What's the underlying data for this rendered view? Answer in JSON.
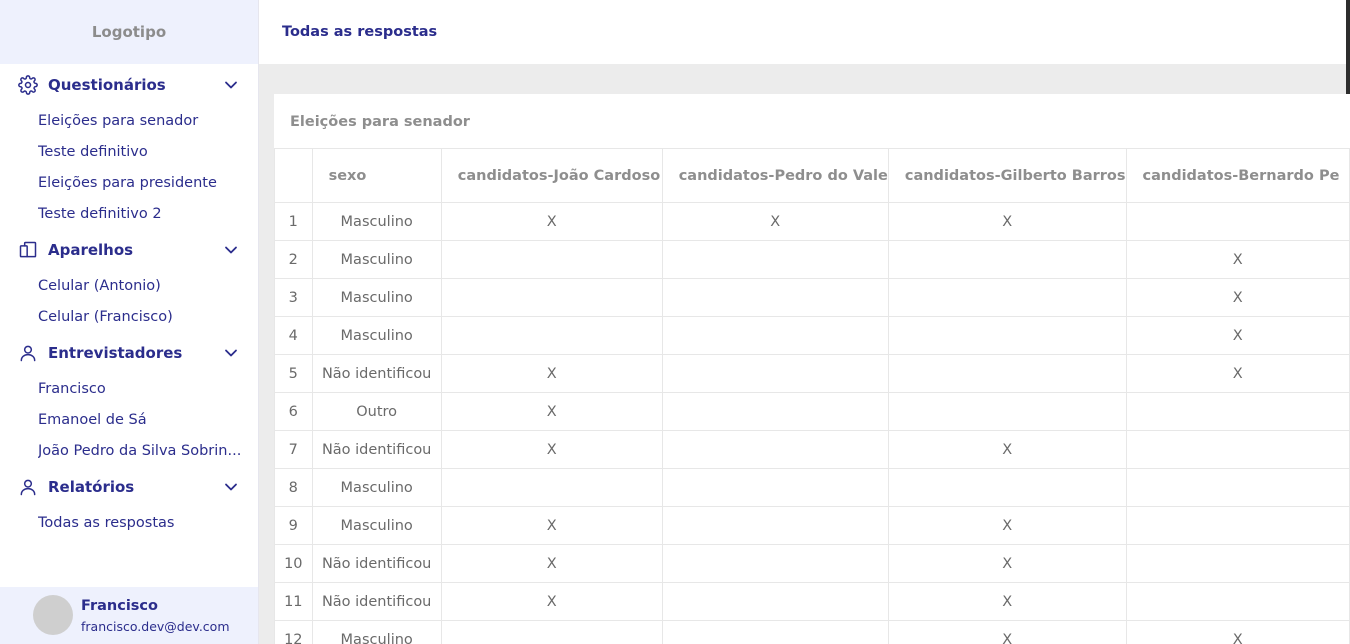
{
  "sidebar": {
    "logo": "Logotipo",
    "sections": [
      {
        "title": "Questionários",
        "icon": "gear-icon",
        "items": [
          "Eleições para senador",
          "Teste definitivo",
          "Eleições para presidente",
          "Teste definitivo 2"
        ]
      },
      {
        "title": "Aparelhos",
        "icon": "devices-icon",
        "items": [
          "Celular (Antonio)",
          "Celular (Francisco)"
        ]
      },
      {
        "title": "Entrevistadores",
        "icon": "user-icon",
        "items": [
          "Francisco",
          "Emanoel de Sá",
          "João Pedro da Silva Sobrin..."
        ]
      },
      {
        "title": "Relatórios",
        "icon": "user-icon",
        "items": [
          "Todas as respostas"
        ]
      }
    ],
    "user": {
      "name": "Francisco",
      "email": "francisco.dev@dev.com"
    }
  },
  "header": {
    "title": "Todas as respostas"
  },
  "card": {
    "title": "Eleições para senador",
    "columns": [
      "",
      "sexo",
      "candidatos-João Cardoso",
      "candidatos-Pedro do Vale",
      "candidatos-Gilberto Barros",
      "candidatos-Bernardo Pe"
    ],
    "rows": [
      [
        "1",
        "Masculino",
        "X",
        "X",
        "X",
        ""
      ],
      [
        "2",
        "Masculino",
        "",
        "",
        "",
        "X"
      ],
      [
        "3",
        "Masculino",
        "",
        "",
        "",
        "X"
      ],
      [
        "4",
        "Masculino",
        "",
        "",
        "",
        "X"
      ],
      [
        "5",
        "Não identificou",
        "X",
        "",
        "",
        "X"
      ],
      [
        "6",
        "Outro",
        "X",
        "",
        "",
        ""
      ],
      [
        "7",
        "Não identificou",
        "X",
        "",
        "X",
        ""
      ],
      [
        "8",
        "Masculino",
        "",
        "",
        "",
        ""
      ],
      [
        "9",
        "Masculino",
        "X",
        "",
        "X",
        ""
      ],
      [
        "10",
        "Não identificou",
        "X",
        "",
        "X",
        ""
      ],
      [
        "11",
        "Não identificou",
        "X",
        "",
        "X",
        ""
      ],
      [
        "12",
        "Masculino",
        "",
        "",
        "X",
        "X"
      ]
    ]
  },
  "colors": {
    "accent": "#2b2d8c",
    "sidebar_bg": "#eef1fd",
    "muted": "#8e8e8e",
    "band": "#ececec"
  }
}
